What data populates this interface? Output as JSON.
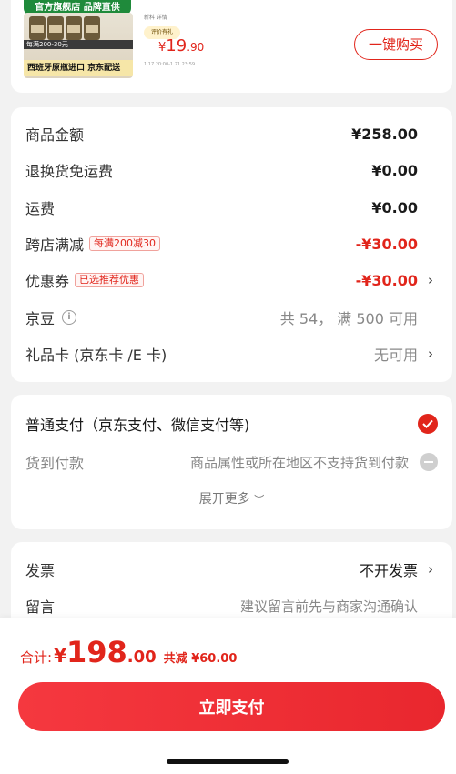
{
  "product": {
    "official_tag": "官方旗舰店 品牌直供",
    "thumb_bar1": "每满200-30元",
    "thumb_bar2": "西班牙原瓶进口 京东配送",
    "side_line1": "新料 详情",
    "side_badge": "评价有礼",
    "side_date": "1.17 20:00-1.21 23:59",
    "price_yen": "¥",
    "price_int": "19",
    "price_dec": ".90",
    "buy_button": "一键购买"
  },
  "summary": {
    "rows": [
      {
        "label": "商品金额",
        "value": "¥258.00"
      },
      {
        "label": "退换货免运费",
        "value": "¥0.00"
      },
      {
        "label": "运费",
        "value": "¥0.00"
      },
      {
        "label": "跨店满减",
        "chip": "每满200减30",
        "value": "-¥30.00"
      },
      {
        "label": "优惠券",
        "chip": "已选推荐优惠",
        "value": "-¥30.00"
      },
      {
        "label": "京豆",
        "value": "共 54， 满 500 可用"
      },
      {
        "label": "礼品卡 (京东卡 /E 卡)",
        "value": "无可用"
      }
    ]
  },
  "payment": {
    "option1": "普通支付（京东支付、微信支付等)",
    "option2_label": "货到付款",
    "option2_note": "商品属性或所在地区不支持货到付款",
    "expand": "展开更多"
  },
  "invoice": {
    "label": "发票",
    "value": "不开发票",
    "note_label": "留言",
    "note_placeholder": "建议留言前先与商家沟通确认"
  },
  "footer": {
    "total_label": "合计:",
    "total_yen": "¥",
    "total_int": "198",
    "total_dec": ".00",
    "discount": "共减 ¥60.00",
    "pay_button": "立即支付"
  },
  "colors": {
    "accent": "#e1251b",
    "tag_green": "#1f8a3b"
  }
}
